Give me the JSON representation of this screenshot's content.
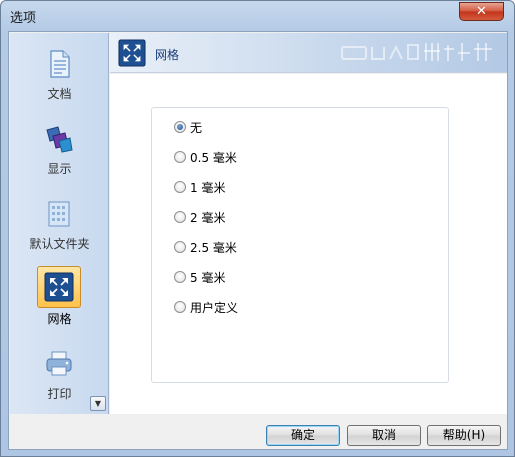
{
  "window": {
    "title": "选项",
    "close_glyph": "✕"
  },
  "sidebar": {
    "items": [
      {
        "label": "文档",
        "icon": "document-icon"
      },
      {
        "label": "显示",
        "icon": "display-icon"
      },
      {
        "label": "默认文件夹",
        "icon": "folder-icon"
      },
      {
        "label": "网格",
        "icon": "grid-icon",
        "selected": true
      },
      {
        "label": "打印",
        "icon": "printer-icon"
      }
    ],
    "scroll_glyph": "▼"
  },
  "header": {
    "title": "网格",
    "icon": "grid-icon"
  },
  "grid_options": {
    "selected": "无",
    "options": [
      {
        "label": "无",
        "checked": true
      },
      {
        "label": "0.5 毫米",
        "checked": false
      },
      {
        "label": "1 毫米",
        "checked": false
      },
      {
        "label": "2 毫米",
        "checked": false
      },
      {
        "label": "2.5 毫米",
        "checked": false
      },
      {
        "label": "5 毫米",
        "checked": false
      },
      {
        "label": "用户定义",
        "checked": false
      }
    ]
  },
  "buttons": {
    "ok": "确定",
    "cancel": "取消",
    "help": "帮助(H)"
  },
  "colors": {
    "accent": "#1a3c7a",
    "selection": "#ffc24a",
    "close": "#c0341a"
  }
}
